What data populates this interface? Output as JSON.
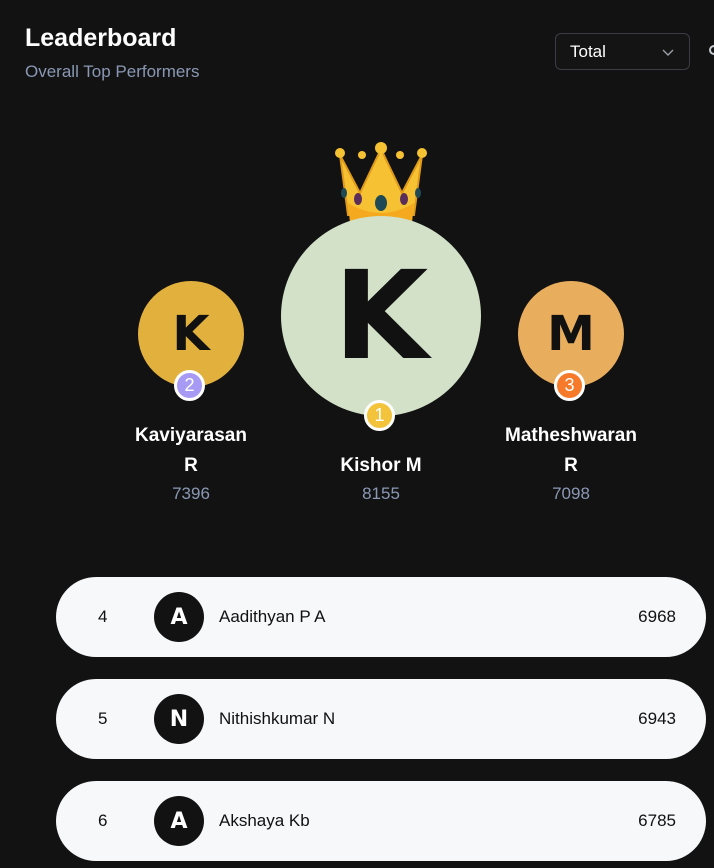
{
  "header": {
    "title": "Leaderboard",
    "subtitle": "Overall Top Performers",
    "filter": {
      "selected": "Total",
      "icon": "chevron-down-icon"
    }
  },
  "podium": [
    {
      "rank": "2",
      "initial": "K",
      "name": "Kaviyarasan R",
      "name_line1": "Kaviyarasan",
      "name_line2": "R",
      "score": "7396",
      "avatar_color": "#e1b03d",
      "badge_color": "#a79af5"
    },
    {
      "rank": "1",
      "initial": "K",
      "name": "Kishor M",
      "score": "8155",
      "avatar_color": "#d2e1c8",
      "badge_color": "#f4c33c",
      "decoration": "crown-icon"
    },
    {
      "rank": "3",
      "initial": "M",
      "name": "Matheshwaran R",
      "name_line1": "Matheshwaran",
      "name_line2": "R",
      "score": "7098",
      "avatar_color": "#e8ae5e",
      "badge_color": "#f67a2a"
    }
  ],
  "list": [
    {
      "rank": "4",
      "initial": "A",
      "name": "Aadithyan P A",
      "score": "6968"
    },
    {
      "rank": "5",
      "initial": "N",
      "name": "Nithishkumar N",
      "score": "6943"
    },
    {
      "rank": "6",
      "initial": "A",
      "name": "Akshaya Kb",
      "score": "6785"
    }
  ],
  "colors": {
    "background": "#121212",
    "muted_text": "#8a98b4",
    "row_background": "#f7f8fa"
  }
}
